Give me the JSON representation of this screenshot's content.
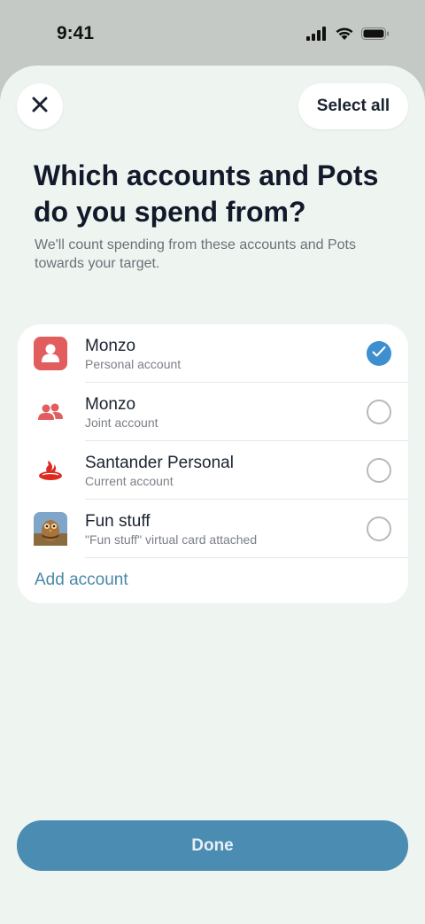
{
  "status_bar": {
    "time": "9:41"
  },
  "header": {
    "select_all_label": "Select all"
  },
  "title": "Which accounts and Pots do you spend from?",
  "subtitle": "We'll count spending from these accounts and Pots towards your target.",
  "accounts": [
    {
      "name": "Monzo",
      "description": "Personal account",
      "icon": "person-icon",
      "checked": true
    },
    {
      "name": "Monzo",
      "description": "Joint account",
      "icon": "people-icon",
      "checked": false
    },
    {
      "name": "Santander Personal",
      "description": "Current account",
      "icon": "santander-flame-icon",
      "checked": false
    },
    {
      "name": "Fun stuff",
      "description": "\"Fun stuff\" virtual card attached",
      "icon": "pot-image-icon",
      "checked": false
    }
  ],
  "add_account_label": "Add account",
  "done_label": "Done",
  "colors": {
    "accent": "#4b8cb3",
    "check": "#3d8fd0",
    "monzo_red": "#e25d5d",
    "santander_red": "#dc2a1e",
    "sheet_bg": "#eef4ef"
  }
}
